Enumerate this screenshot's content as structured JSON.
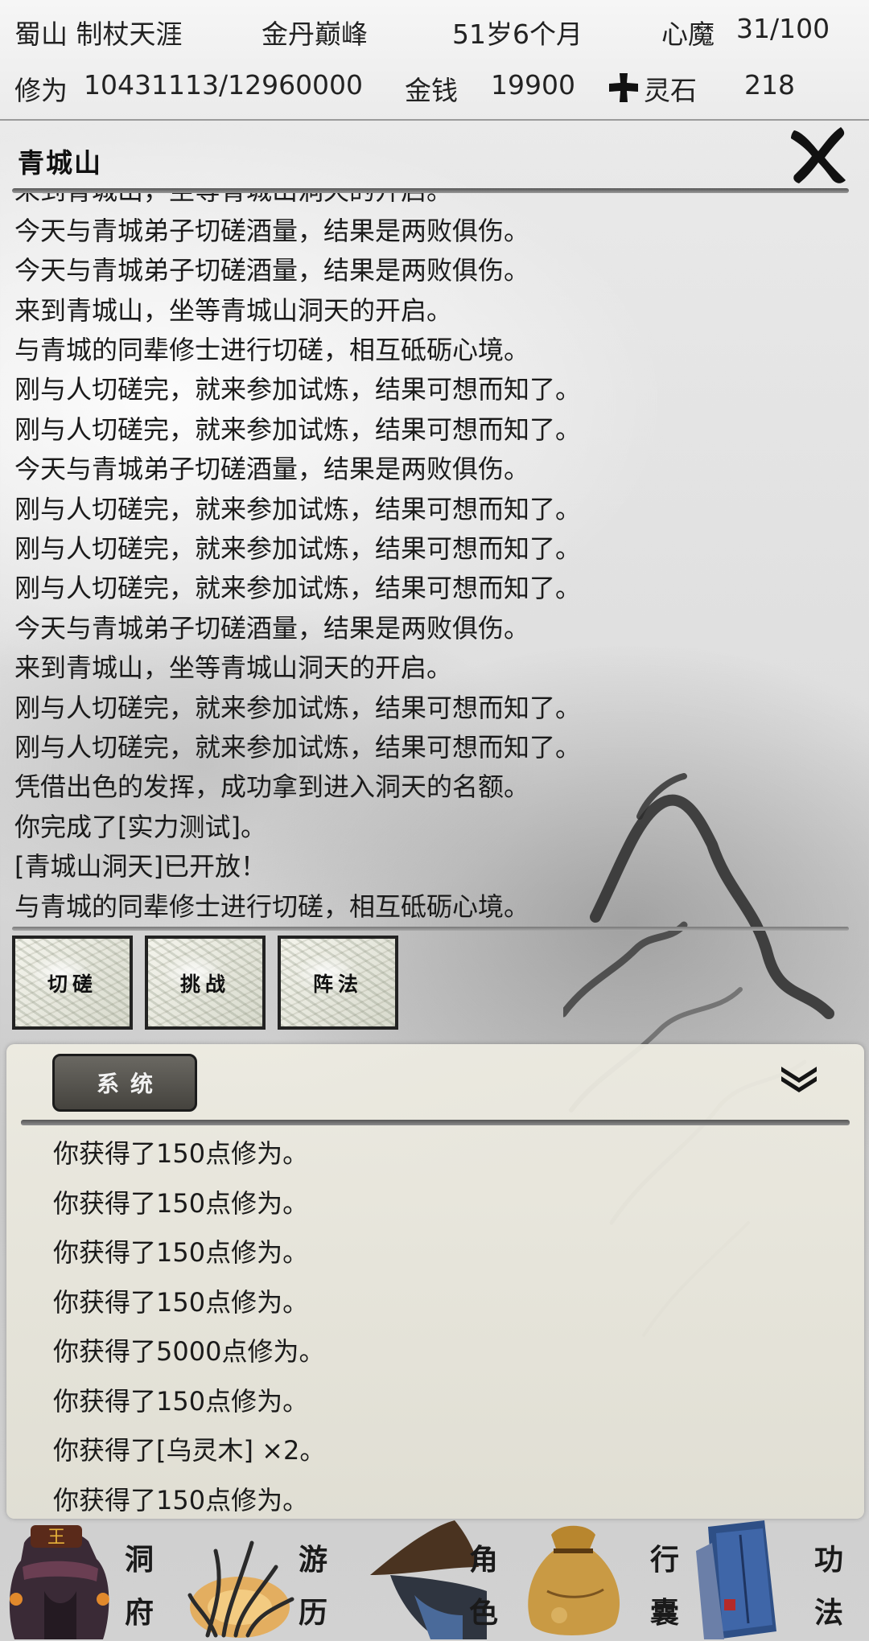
{
  "status": {
    "location": "蜀山 制杖天涯",
    "realm": "金丹巅峰",
    "age": "51岁6个月",
    "demon_label": "心魔",
    "demon_value": "31/100",
    "cultivation_label": "修为",
    "cultivation_value": "10431113/12960000",
    "money_label": "金钱",
    "money_value": "19900",
    "spirit_stone_label": "灵石",
    "spirit_stone_value": "218"
  },
  "panel": {
    "title": "青城山",
    "log": [
      "来到青城山，坐等青城山洞天的开启。",
      "今天与青城弟子切磋酒量，结果是两败俱伤。",
      "今天与青城弟子切磋酒量，结果是两败俱伤。",
      "来到青城山，坐等青城山洞天的开启。",
      "与青城的同辈修士进行切磋，相互砥砺心境。",
      "刚与人切磋完，就来参加试炼，结果可想而知了。",
      "刚与人切磋完，就来参加试炼，结果可想而知了。",
      "今天与青城弟子切磋酒量，结果是两败俱伤。",
      "刚与人切磋完，就来参加试炼，结果可想而知了。",
      "刚与人切磋完，就来参加试炼，结果可想而知了。",
      "刚与人切磋完，就来参加试炼，结果可想而知了。",
      "今天与青城弟子切磋酒量，结果是两败俱伤。",
      "来到青城山，坐等青城山洞天的开启。",
      "刚与人切磋完，就来参加试炼，结果可想而知了。",
      "刚与人切磋完，就来参加试炼，结果可想而知了。",
      "凭借出色的发挥，成功拿到进入洞天的名额。",
      "你完成了[实力测试]。",
      "[青城山洞天]已开放！",
      "与青城的同辈修士进行切磋，相互砥砺心境。"
    ]
  },
  "actions": {
    "spar": "切磋",
    "challenge": "挑战",
    "formation": "阵法"
  },
  "system": {
    "tab_label": "系统",
    "messages": [
      "你获得了150点修为。",
      "你获得了150点修为。",
      "你获得了150点修为。",
      "你获得了150点修为。",
      "你获得了5000点修为。",
      "你获得了150点修为。",
      "你获得了[乌灵木] ×2。",
      "你获得了150点修为。"
    ]
  },
  "nav": [
    {
      "label_top": "洞",
      "label_bottom": "府",
      "icon": "cave-mansion-icon"
    },
    {
      "label_top": "游",
      "label_bottom": "历",
      "icon": "travel-grass-icon"
    },
    {
      "label_top": "角",
      "label_bottom": "色",
      "icon": "character-hat-icon"
    },
    {
      "label_top": "行",
      "label_bottom": "囊",
      "icon": "bag-icon"
    },
    {
      "label_top": "功",
      "label_bottom": "法",
      "icon": "skill-book-icon"
    }
  ],
  "colors": {
    "ink": "#1a1a1a",
    "panel_bg": "#ebe9df",
    "tab_bg": "#55534e",
    "travel_glow": "#e8a23a"
  }
}
